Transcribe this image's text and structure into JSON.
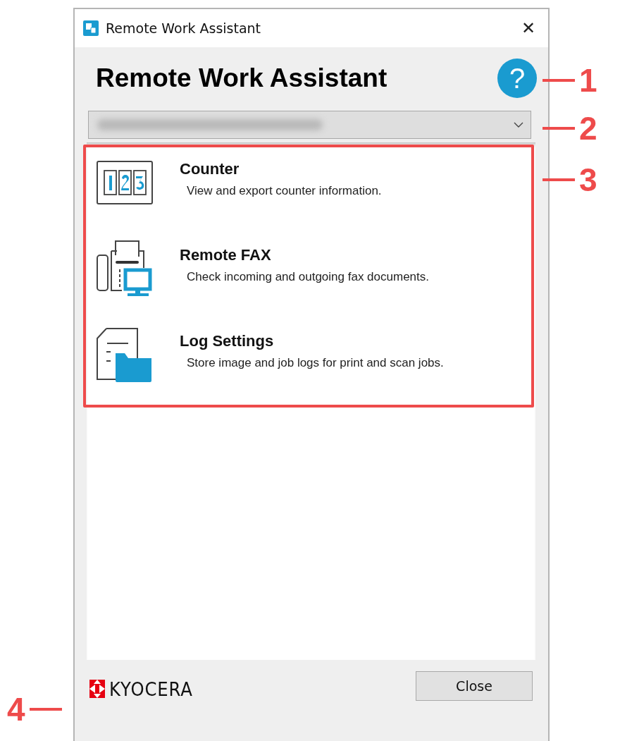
{
  "window": {
    "title": "Remote Work Assistant",
    "close": "✕"
  },
  "heading": "Remote Work Assistant",
  "help": "?",
  "features": [
    {
      "kind": "counter",
      "title": "Counter",
      "description": "View and export counter information."
    },
    {
      "kind": "fax",
      "title": "Remote FAX",
      "description": "Check incoming and outgoing fax documents."
    },
    {
      "kind": "log",
      "title": "Log Settings",
      "description": "Store image and job logs for print and scan jobs."
    }
  ],
  "logo": "KYOCERA",
  "buttons": [
    "Close"
  ],
  "callouts": [
    {
      "number": "1"
    },
    {
      "number": "2"
    },
    {
      "number": "3"
    },
    {
      "number": "4"
    }
  ]
}
